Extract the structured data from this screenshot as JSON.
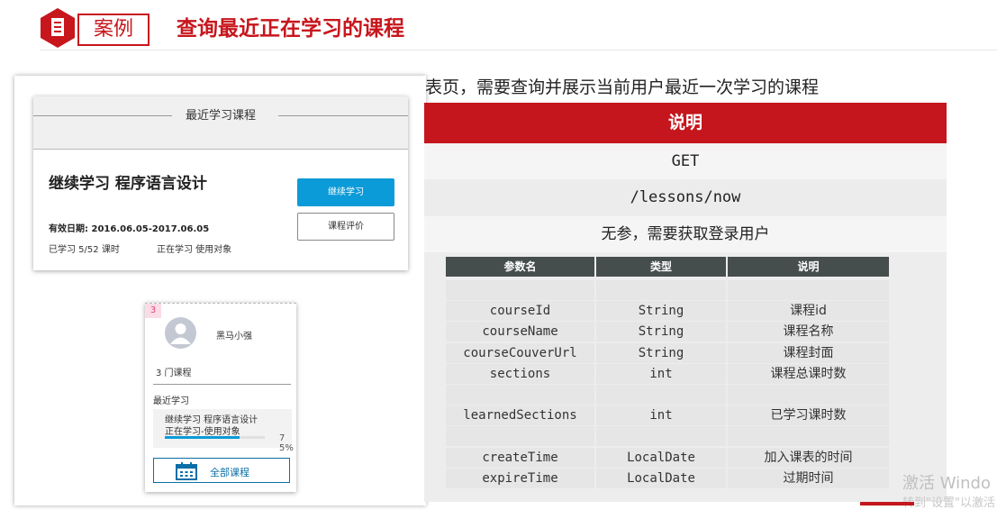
{
  "header": {
    "tag_label": "案例",
    "title": "查询最近正在学习的课程"
  },
  "description": "表页，需要查询并展示当前用户最近一次学习的课程",
  "course_card": {
    "heading": "最近学习课程",
    "course_title": "继续学习  程序语言设计",
    "valid_date": "有效日期: 2016.06.05-2017.06.05",
    "progress_text": "已学习   5/52 课时",
    "status_text": "正在学习  使用对象",
    "continue_button": "继续学习",
    "review_button": "课程评价"
  },
  "user_card": {
    "badge": "3",
    "user_name": "黑马小强",
    "course_count": "3  门课程",
    "recent_label": "最近学习",
    "recent_course": "继续学习 程序语言设计",
    "recent_status": "正在学习-使用对象",
    "recent_percent": "75%",
    "recent_progress": 0.75,
    "all_courses_button": "全部课程"
  },
  "spec": {
    "header": "说明",
    "method": "GET",
    "path": "/lessons/now",
    "params_note": "无参，需要获取登录用户",
    "columns": [
      "参数名",
      "类型",
      "说明"
    ],
    "rows": [
      [
        "",
        "",
        ""
      ],
      [
        "courseId",
        "String",
        "课程id"
      ],
      [
        "courseName",
        "String",
        "课程名称"
      ],
      [
        "courseCouverUrl",
        "String",
        "课程封面"
      ],
      [
        "sections",
        "int",
        "课程总课时数"
      ],
      [
        "",
        "",
        ""
      ],
      [
        "learnedSections",
        "int",
        "已学习课时数"
      ],
      [
        "",
        "",
        ""
      ],
      [
        "createTime",
        "LocalDate",
        "加入课表的时间"
      ],
      [
        "expireTime",
        "LocalDate",
        "过期时间"
      ]
    ]
  },
  "watermark": {
    "line1": "激活 Windo",
    "line2": "转到\"设置\"以激活"
  },
  "colors": {
    "brand_red": "#c4161c",
    "accent_blue": "#0a9bd8",
    "table_header": "#464d4d"
  }
}
